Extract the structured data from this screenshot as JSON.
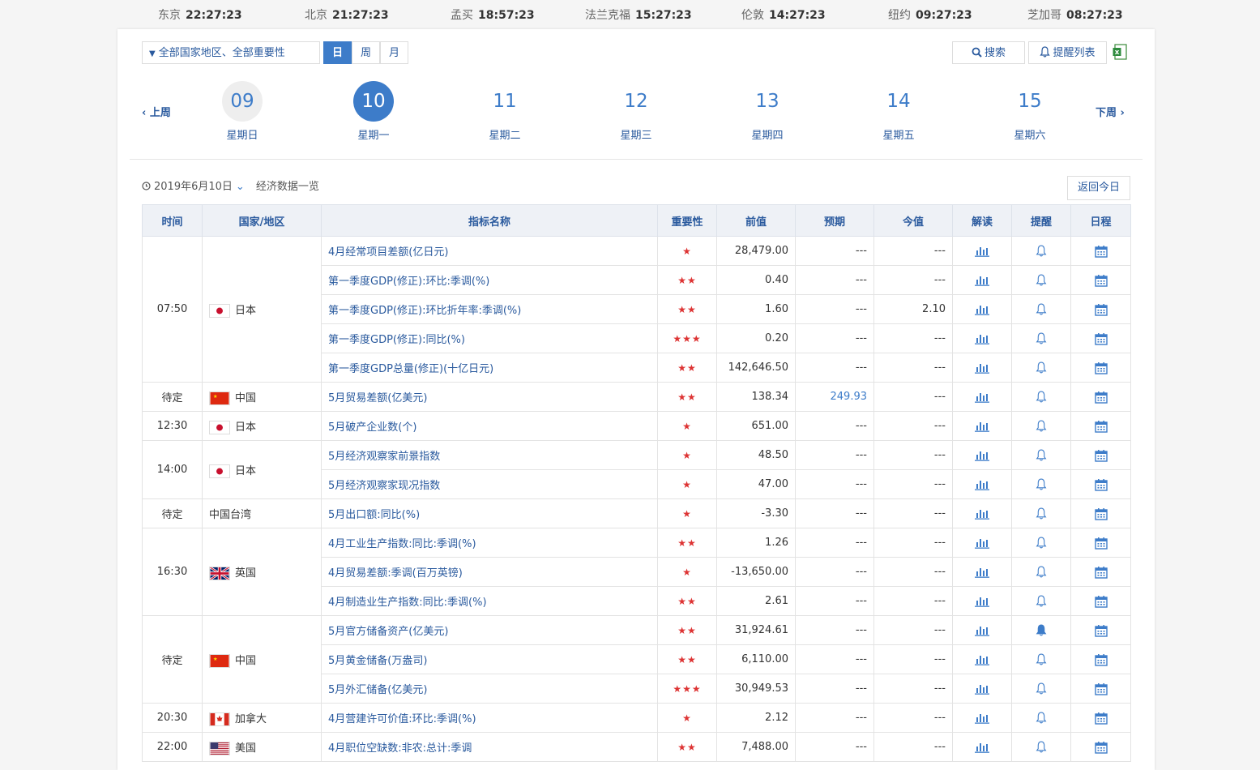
{
  "clocks": [
    {
      "city": "东京",
      "time": "22:27:23"
    },
    {
      "city": "北京",
      "time": "21:27:23"
    },
    {
      "city": "孟买",
      "time": "18:57:23"
    },
    {
      "city": "法兰克福",
      "time": "15:27:23"
    },
    {
      "city": "伦敦",
      "time": "14:27:23"
    },
    {
      "city": "纽约",
      "time": "09:27:23"
    },
    {
      "city": "芝加哥",
      "time": "08:27:23"
    }
  ],
  "toolbar": {
    "filter_label": "全部国家地区、全部重要性",
    "period_day": "日",
    "period_week": "周",
    "period_month": "月",
    "search_label": "搜索",
    "alert_list_label": "提醒列表"
  },
  "week_nav": {
    "prev": "上周",
    "next": "下周"
  },
  "days": [
    {
      "num": "09",
      "weekday": "星期日"
    },
    {
      "num": "10",
      "weekday": "星期一"
    },
    {
      "num": "11",
      "weekday": "星期二"
    },
    {
      "num": "12",
      "weekday": "星期三"
    },
    {
      "num": "13",
      "weekday": "星期四"
    },
    {
      "num": "14",
      "weekday": "星期五"
    },
    {
      "num": "15",
      "weekday": "星期六"
    }
  ],
  "date_line": {
    "date": "2019年6月10日",
    "subtitle": "经济数据一览",
    "today_button": "返回今日"
  },
  "table": {
    "headers": [
      "时间",
      "国家/地区",
      "指标名称",
      "重要性",
      "前值",
      "预期",
      "今值",
      "解读",
      "提醒",
      "日程"
    ],
    "groups": [
      {
        "time": "07:50",
        "country": "日本",
        "flag": "jp",
        "rows": [
          {
            "name": "4月经常项目差额(亿日元)",
            "stars": "★",
            "prev": "28,479.00",
            "exp": "---",
            "act": "---"
          },
          {
            "name": "第一季度GDP(修正):环比:季调(%)",
            "stars": "★★",
            "prev": "0.40",
            "exp": "---",
            "act": "---"
          },
          {
            "name": "第一季度GDP(修正):环比折年率:季调(%)",
            "stars": "★★",
            "prev": "1.60",
            "exp": "---",
            "act": "2.10"
          },
          {
            "name": "第一季度GDP(修正):同比(%)",
            "stars": "★★★",
            "prev": "0.20",
            "exp": "---",
            "act": "---"
          },
          {
            "name": "第一季度GDP总量(修正)(十亿日元)",
            "stars": "★★",
            "prev": "142,646.50",
            "exp": "---",
            "act": "---"
          }
        ]
      },
      {
        "time": "待定",
        "country": "中国",
        "flag": "cn",
        "rows": [
          {
            "name": "5月贸易差额(亿美元)",
            "stars": "★★",
            "prev": "138.34",
            "exp": "249.93",
            "act": "---"
          }
        ]
      },
      {
        "time": "12:30",
        "country": "日本",
        "flag": "jp",
        "rows": [
          {
            "name": "5月破产企业数(个)",
            "stars": "★",
            "prev": "651.00",
            "exp": "---",
            "act": "---"
          }
        ]
      },
      {
        "time": "14:00",
        "country": "日本",
        "flag": "jp",
        "rows": [
          {
            "name": "5月经济观察家前景指数",
            "stars": "★",
            "prev": "48.50",
            "exp": "---",
            "act": "---"
          },
          {
            "name": "5月经济观察家现况指数",
            "stars": "★",
            "prev": "47.00",
            "exp": "---",
            "act": "---"
          }
        ]
      },
      {
        "time": "待定",
        "country": "中国台湾",
        "flag": "",
        "rows": [
          {
            "name": "5月出口额:同比(%)",
            "stars": "★",
            "prev": "-3.30",
            "exp": "---",
            "act": "---"
          }
        ]
      },
      {
        "time": "16:30",
        "country": "英国",
        "flag": "gb",
        "rows": [
          {
            "name": "4月工业生产指数:同比:季调(%)",
            "stars": "★★",
            "prev": "1.26",
            "exp": "---",
            "act": "---"
          },
          {
            "name": "4月贸易差额:季调(百万英镑)",
            "stars": "★",
            "prev": "-13,650.00",
            "exp": "---",
            "act": "---"
          },
          {
            "name": "4月制造业生产指数:同比:季调(%)",
            "stars": "★★",
            "prev": "2.61",
            "exp": "---",
            "act": "---"
          }
        ]
      },
      {
        "time": "待定",
        "country": "中国",
        "flag": "cn",
        "rows": [
          {
            "name": "5月官方储备资产(亿美元)",
            "stars": "★★",
            "prev": "31,924.61",
            "exp": "---",
            "act": "---",
            "alert": true
          },
          {
            "name": "5月黄金储备(万盎司)",
            "stars": "★★",
            "prev": "6,110.00",
            "exp": "---",
            "act": "---"
          },
          {
            "name": "5月外汇储备(亿美元)",
            "stars": "★★★",
            "prev": "30,949.53",
            "exp": "---",
            "act": "---"
          }
        ]
      },
      {
        "time": "20:30",
        "country": "加拿大",
        "flag": "ca",
        "rows": [
          {
            "name": "4月营建许可价值:环比:季调(%)",
            "stars": "★",
            "prev": "2.12",
            "exp": "---",
            "act": "---"
          }
        ]
      },
      {
        "time": "22:00",
        "country": "美国",
        "flag": "us",
        "rows": [
          {
            "name": "4月职位空缺数:非农:总计:季调",
            "stars": "★★",
            "prev": "7,488.00",
            "exp": "---",
            "act": "---"
          }
        ]
      }
    ]
  },
  "colors": {
    "accent": "#3d7cc9",
    "link": "#2a5a9e",
    "star": "#dd3333"
  }
}
